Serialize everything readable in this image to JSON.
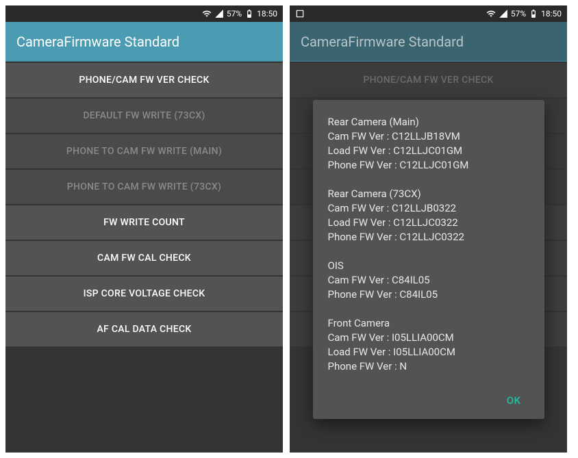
{
  "status": {
    "battery": "57%",
    "time": "18:50"
  },
  "app_title": "CameraFirmware Standard",
  "menu": [
    {
      "label": "PHONE/CAM FW VER CHECK",
      "enabled": true
    },
    {
      "label": "DEFAULT FW WRITE (73CX)",
      "enabled": false
    },
    {
      "label": "PHONE TO CAM FW WRITE (MAIN)",
      "enabled": false
    },
    {
      "label": "PHONE TO CAM FW WRITE (73CX)",
      "enabled": false
    },
    {
      "label": "FW WRITE COUNT",
      "enabled": true
    },
    {
      "label": "CAM FW CAL CHECK",
      "enabled": true
    },
    {
      "label": "ISP CORE VOLTAGE CHECK",
      "enabled": true
    },
    {
      "label": "AF CAL DATA CHECK",
      "enabled": true
    }
  ],
  "dialog": {
    "sections": [
      {
        "title": "Rear Camera (Main)",
        "lines": [
          "Cam FW Ver : C12LLJB18VM",
          "Load FW Ver : C12LLJC01GM",
          "Phone FW Ver : C12LLJC01GM"
        ]
      },
      {
        "title": "Rear Camera (73CX)",
        "lines": [
          "Cam FW Ver : C12LLJB0322",
          "Load FW Ver : C12LLJC0322",
          "Phone FW Ver : C12LLJC0322"
        ]
      },
      {
        "title": "OIS",
        "lines": [
          "Cam FW Ver : C84IL05",
          "Phone FW Ver : C84IL05"
        ]
      },
      {
        "title": "Front Camera",
        "lines": [
          "Cam FW Ver : I05LLIA00CM",
          "Load FW Ver : I05LLIA00CM",
          "Phone FW Ver : N"
        ]
      }
    ],
    "ok": "OK"
  }
}
